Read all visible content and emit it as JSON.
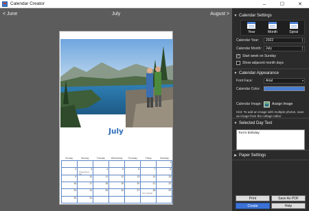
{
  "window": {
    "title": "Calendar Creator",
    "controls": [
      "–",
      "☐",
      "✕"
    ]
  },
  "nav": {
    "prev": "< June",
    "current": "July",
    "next": "August >"
  },
  "calendar": {
    "month_title": "July",
    "days": [
      "Sunday",
      "Monday",
      "Tuesday",
      "Wednesday",
      "Thursday",
      "Friday",
      "Saturday"
    ],
    "cells": [
      "",
      "",
      "",
      "",
      "",
      "",
      "1",
      "2",
      "3",
      "4",
      "5",
      "6",
      "7",
      "8",
      "9",
      "10",
      "11",
      "12",
      "13",
      "14",
      "15",
      "16",
      "17",
      "18",
      "19",
      "20",
      "21",
      "22",
      "23",
      "24",
      "25",
      "26",
      "27",
      "28",
      "29",
      "30",
      "31",
      "",
      "",
      "",
      "",
      ""
    ],
    "events": [
      {
        "cell": 8,
        "text": "Independence Day"
      },
      {
        "cell": 33,
        "text": "Tom's birthday"
      }
    ]
  },
  "panel": {
    "calendar_settings": {
      "header": "Calendar Settings",
      "views": [
        {
          "label": "Year",
          "icon": "calendar-year-icon"
        },
        {
          "label": "Month",
          "icon": "calendar-month-icon"
        },
        {
          "label": "Spiral",
          "icon": "calendar-spiral-icon"
        }
      ],
      "year_label": "Calendar Year:",
      "year_value": "2022",
      "month_label": "Calendar Month:",
      "month_value": "July",
      "start_monday_label": "Start week on Sunday",
      "start_monday_checked": true,
      "adjacent_label": "Show adjacent month days",
      "adjacent_checked": false
    },
    "appearance": {
      "header": "Calendar Appearance",
      "font_label": "Font Face:",
      "font_value": "Arial",
      "color_label": "Calendar Color:",
      "color_value": "#4a7fd4",
      "image_label": "Calendar Image:",
      "assign_label": "Assign Image",
      "hint": "Hint: To add an image with multiple photos, save an image from the collage editor"
    },
    "day_text": {
      "header": "Selected Day Text",
      "value": "Tom's birthday"
    },
    "paper": {
      "header": "Paper Settings"
    },
    "buttons": {
      "print": "Print",
      "save_pdf": "Save As PDF",
      "create": "Create",
      "help": "Help"
    }
  },
  "colors": {
    "accent": "#3b72d6",
    "month_title": "#2e6db8",
    "grid": "#5a84c4",
    "panel_bg": "#2b2b2b",
    "preview_bg": "#5c5c5c"
  }
}
